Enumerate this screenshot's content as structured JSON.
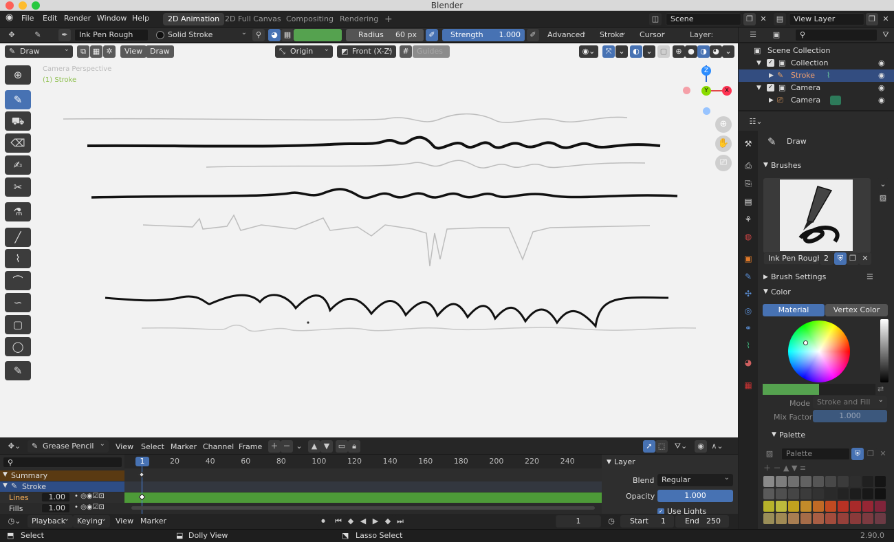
{
  "app": {
    "window_title": "Blender",
    "version": "2.90.0"
  },
  "menus": [
    "File",
    "Edit",
    "Render",
    "Window",
    "Help"
  ],
  "workspaces": [
    {
      "label": "2D Animation",
      "active": true
    },
    {
      "label": "2D Full Canvas",
      "active": false
    },
    {
      "label": "Compositing",
      "active": false
    },
    {
      "label": "Rendering",
      "active": false
    }
  ],
  "add_workspace": "+",
  "scene": {
    "label": "Scene",
    "view_layer": "View Layer"
  },
  "tool_settings": {
    "brush": "Ink Pen Rough",
    "material": "Solid Stroke",
    "radius_label": "Radius",
    "radius_value": "60 px",
    "strength_label": "Strength",
    "strength_value": "1.000",
    "advanced": "Advanced",
    "stroke": "Stroke",
    "cursor": "Cursor",
    "layer_label": "Layer:"
  },
  "viewport_header": {
    "mode": "Draw",
    "view": "View",
    "draw": "Draw",
    "origin": "Origin",
    "view_axis": "Front (X-Z)",
    "guides": "Guides"
  },
  "viewport": {
    "perspective_label": "Camera Perspective",
    "object_label": "(1) Stroke",
    "gizmo": {
      "z": "Z",
      "y": "Y",
      "x": "X"
    }
  },
  "tools": [
    "cursor",
    "draw",
    "fill",
    "erase",
    "tint",
    "cutter",
    "eyedropper",
    "line",
    "polyline",
    "arc",
    "curve",
    "box",
    "circle",
    "annotate"
  ],
  "outliner": {
    "items": [
      {
        "label": "Scene Collection",
        "level": 0
      },
      {
        "label": "Collection",
        "level": 1
      },
      {
        "label": "Stroke",
        "level": 2,
        "selected": true
      },
      {
        "label": "Camera",
        "level": 1
      },
      {
        "label": "Camera",
        "level": 2
      }
    ]
  },
  "properties": {
    "tool_name": "Draw",
    "brushes_header": "Brushes",
    "brush_name": "Ink Pen Rough",
    "brush_users": "2",
    "brush_settings": "Brush Settings",
    "color_header": "Color",
    "color_modes": [
      "Material",
      "Vertex Color"
    ],
    "mode_label": "Mode",
    "mode_value": "Stroke and Fill",
    "mix_factor_label": "Mix Factor",
    "mix_factor_value": "1.000",
    "palette_header": "Palette",
    "palette_name": "Palette"
  },
  "dopesheet": {
    "editor": "Grease Pencil",
    "menus": [
      "View",
      "Select",
      "Marker",
      "Channel",
      "Frame"
    ],
    "frame_ticks": [
      "20",
      "40",
      "60",
      "80",
      "100",
      "120",
      "140",
      "160",
      "180",
      "200",
      "220",
      "240"
    ],
    "current_frame_marker": "1",
    "channels": [
      {
        "label": "Summary"
      },
      {
        "label": "Stroke"
      },
      {
        "label": "Lines",
        "value": "1.00"
      },
      {
        "label": "Fills",
        "value": "1.00"
      }
    ],
    "layer_panel": {
      "title": "Layer",
      "blend_label": "Blend",
      "blend_value": "Regular",
      "opacity_label": "Opacity",
      "opacity_value": "1.000",
      "use_lights": "Use Lights"
    }
  },
  "timeline": {
    "menus": [
      "Playback",
      "Keying",
      "View",
      "Marker"
    ],
    "current_frame": "1",
    "start_label": "Start",
    "start_value": "1",
    "end_label": "End",
    "end_value": "250"
  },
  "statusbar": {
    "select": "Select",
    "dolly": "Dolly View",
    "lasso": "Lasso Select"
  },
  "colors": {
    "accent": "#4772b3",
    "active_color": "#55a24f",
    "viewport_bg": "#f2f2f2"
  }
}
